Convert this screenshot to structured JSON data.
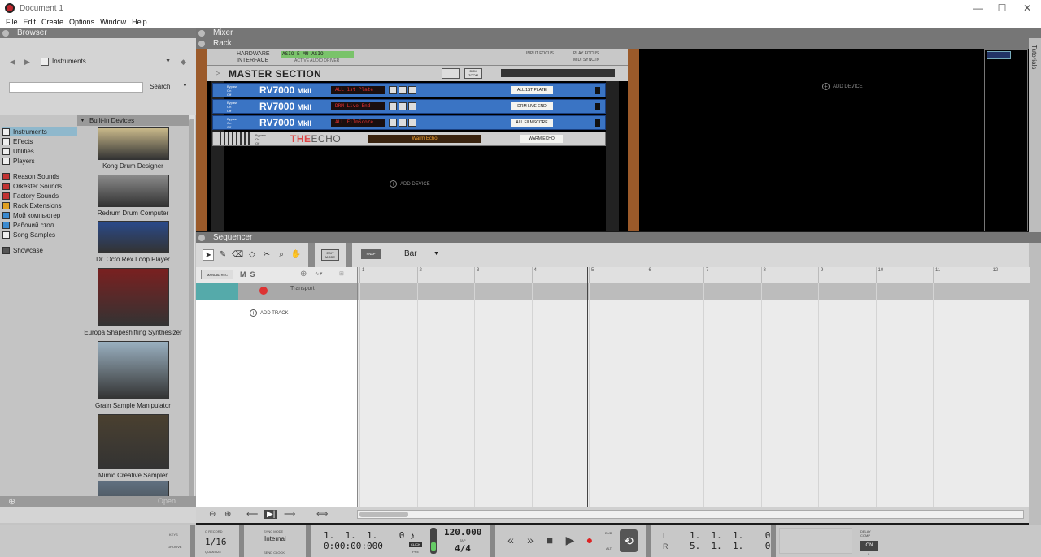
{
  "window": {
    "title": "Document 1",
    "min": "—",
    "max": "☐",
    "close": "✕"
  },
  "menu": [
    "File",
    "Edit",
    "Create",
    "Options",
    "Window",
    "Help"
  ],
  "browser": {
    "title": "Browser",
    "location": "Instruments",
    "search_label": "Search",
    "search_value": "",
    "locations": [
      {
        "label": "Instruments",
        "icon": "instruments-icon",
        "color": "#eeeeee",
        "selected": true
      },
      {
        "label": "Effects",
        "icon": "effects-icon",
        "color": "#eeeeee"
      },
      {
        "label": "Utilities",
        "icon": "utilities-icon",
        "color": "#eeeeee"
      },
      {
        "label": "Players",
        "icon": "players-icon",
        "color": "#eeeeee"
      },
      {
        "label": "Reason Sounds",
        "icon": "reason-sounds-icon",
        "color": "#c33333",
        "gap": true
      },
      {
        "label": "Orkester Sounds",
        "icon": "orkester-sounds-icon",
        "color": "#c33333"
      },
      {
        "label": "Factory Sounds",
        "icon": "factory-sounds-icon",
        "color": "#c33333"
      },
      {
        "label": "Rack Extensions",
        "icon": "rack-extensions-icon",
        "color": "#e0a020"
      },
      {
        "label": "Мой компьютер",
        "icon": "computer-icon",
        "color": "#3a8ad0"
      },
      {
        "label": "Рабочий стол",
        "icon": "desktop-icon",
        "color": "#3a8ad0"
      },
      {
        "label": "Song Samples",
        "icon": "song-samples-icon",
        "color": "#eeeeee"
      },
      {
        "label": "Showcase",
        "icon": "showcase-star-icon",
        "color": "#555555",
        "gap": true
      }
    ],
    "devices_header": "Built-in Devices",
    "devices": [
      {
        "name": "Kong Drum Designer",
        "color": "#c9b98a"
      },
      {
        "name": "Redrum Drum Computer",
        "color": "#8a8a8a"
      },
      {
        "name": "Dr. Octo Rex Loop Player",
        "color": "#2a4a8a"
      },
      {
        "name": "Europa Shapeshifting Synthesizer",
        "color": "#7a2020"
      },
      {
        "name": "Grain Sample Manipulator",
        "color": "#9ab0c0"
      },
      {
        "name": "Mimic Creative Sampler",
        "color": "#4a4030"
      },
      {
        "name": "",
        "color": "#607080"
      }
    ],
    "open_label": "Open"
  },
  "mixer": {
    "title": "Mixer"
  },
  "rack": {
    "title": "Rack",
    "hw_label": "HARDWARE\nINTERFACE",
    "hw_driver": "ASIO E-MU ASIO",
    "hw_sub": "ACTIVE AUDIO DRIVER",
    "hw_opts": [
      "INPUT FOCUS",
      "PLAY FOCUS",
      "MIDI SYNC IN"
    ],
    "master_title": "MASTER SECTION",
    "master_btn": "DRM\nZOOM",
    "units": [
      {
        "name": "RV7000",
        "mk": "MkII",
        "patch": "ALL 1st Plate",
        "tape": "ALL 1ST PLATE"
      },
      {
        "name": "RV7000",
        "mk": "MkII",
        "patch": "DRM Live End",
        "tape": "DRM LIVE END"
      },
      {
        "name": "RV7000",
        "mk": "MkII",
        "patch": "ALL FilmScore",
        "tape": "ALL FILMSCORE"
      }
    ],
    "bypass_label": "Bypass\nOn\nOff",
    "echo": {
      "name_a": "THE",
      "name_b": "ECHO",
      "patch": "Warm Echo",
      "tape": "WARM ECHO"
    },
    "add_device": "ADD DEVICE",
    "tutorials": "Tutorials"
  },
  "sequencer": {
    "title": "Sequencer",
    "edit_mode": "EDIT\nMODE",
    "snap": "SNAP",
    "snap_value": "Bar",
    "manual_rec": "MANUAL REC",
    "ms": "M  S",
    "transport_track": "Transport",
    "add_track": "ADD TRACK",
    "ruler": [
      "1",
      "2",
      "3",
      "4",
      "5",
      "6",
      "7",
      "8",
      "9",
      "10",
      "11",
      "12"
    ]
  },
  "transport": {
    "keys": "KEYS",
    "groove": "GROOVE",
    "q_record": "Q RECORD",
    "quantize_value": "1/16",
    "quantize_label": "QUANTIZE",
    "sync_mode": "SYNC MODE",
    "sync_value": "Internal",
    "send_clock": "SEND CLOCK",
    "position": "1.  1.  1.    0",
    "time": "0:00:00:000",
    "click": "CLICK",
    "pre": "PRE",
    "tempo": "120.000",
    "tap": "TAP",
    "signature": "4/4",
    "dub": "DUB",
    "alt": "ALT",
    "left_loc": "1.  1.  1.    0",
    "right_loc": "5.  1.  1.    0",
    "l_label": "L",
    "r_label": "R",
    "delay_comp": "DELAY\nCOMP",
    "on": "ON",
    "zero": "0"
  }
}
